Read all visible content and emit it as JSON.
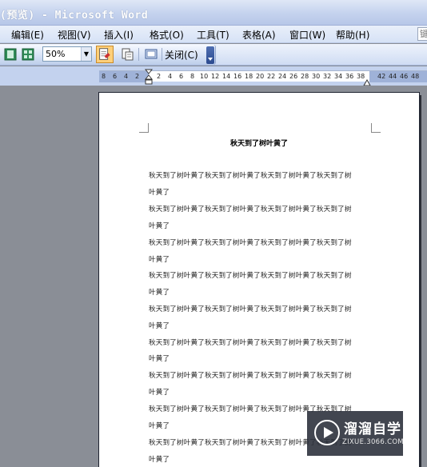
{
  "window": {
    "title": "(预览) - Microsoft Word"
  },
  "menu": {
    "items": [
      {
        "label": "编辑(E)"
      },
      {
        "label": "视图(V)"
      },
      {
        "label": "插入(I)"
      },
      {
        "label": "格式(O)"
      },
      {
        "label": "工具(T)"
      },
      {
        "label": "表格(A)"
      },
      {
        "label": "窗口(W)"
      },
      {
        "label": "帮助(H)"
      }
    ],
    "search_partial": "键"
  },
  "toolbar": {
    "zoom_value": "50%",
    "close_label": "关闭(C)"
  },
  "ruler": {
    "left_ticks": [
      "8",
      "6",
      "4",
      "2"
    ],
    "right_ticks": [
      "2",
      "4",
      "6",
      "8",
      "10",
      "12",
      "14",
      "16",
      "18",
      "20",
      "22",
      "24",
      "26",
      "28",
      "30",
      "32",
      "34",
      "36",
      "38",
      "42",
      "44",
      "46",
      "48"
    ]
  },
  "document": {
    "title": "秋天到了树叶黄了",
    "lines": [
      "秋天到了树叶黄了秋天到了树叶黄了秋天到了树叶黄了秋天到了树",
      "叶黄了",
      "秋天到了树叶黄了秋天到了树叶黄了秋天到了树叶黄了秋天到了树",
      "叶黄了",
      "秋天到了树叶黄了秋天到了树叶黄了秋天到了树叶黄了秋天到了树",
      "叶黄了",
      "秋天到了树叶黄了秋天到了树叶黄了秋天到了树叶黄了秋天到了树",
      "叶黄了",
      "秋天到了树叶黄了秋天到了树叶黄了秋天到了树叶黄了秋天到了树",
      "叶黄了",
      "秋天到了树叶黄了秋天到了树叶黄了秋天到了树叶黄了秋天到了树",
      "叶黄了",
      "秋天到了树叶黄了秋天到了树叶黄了秋天到了树叶黄了秋天到了树",
      "叶黄了",
      "秋天到了树叶黄了秋天到了树叶黄了秋天到了树叶黄了秋天到了树",
      "叶黄了",
      "秋天到了树叶黄了秋天到了树叶黄了秋天到了树叶黄了秋天到了树",
      "叶黄了"
    ]
  },
  "watermark": {
    "text": "溜溜自学",
    "sub": "ZIXUE.3066.COM"
  }
}
